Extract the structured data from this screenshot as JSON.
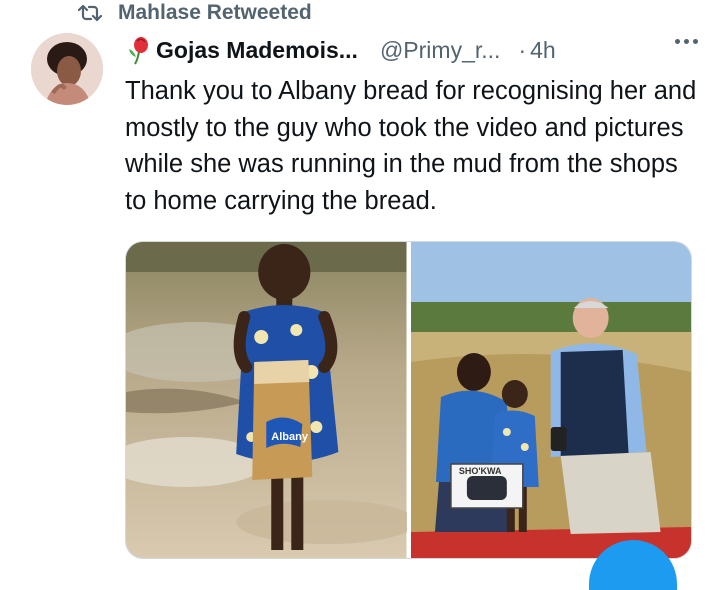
{
  "retweet": {
    "label": "Mahlase Retweeted",
    "icon": "retweet-icon"
  },
  "author": {
    "display_name": "Gojas Mademois...",
    "handle": "@Primy_r...",
    "separator": "·",
    "time": "4h",
    "name_emoji_icon": "rose-icon"
  },
  "tweet": {
    "text": "Thank you to Albany bread for recognising her and mostly to the guy who took the video and pictures while she was running in the mud from the shops to home carrying the bread."
  },
  "media": {
    "photo1_bread_label": "Albany",
    "photo2_box_label": "SHO'KWA"
  },
  "colors": {
    "text_primary": "#0f1419",
    "text_secondary": "#536471",
    "accent": "#1d9bf0",
    "border": "#cfd9de"
  }
}
